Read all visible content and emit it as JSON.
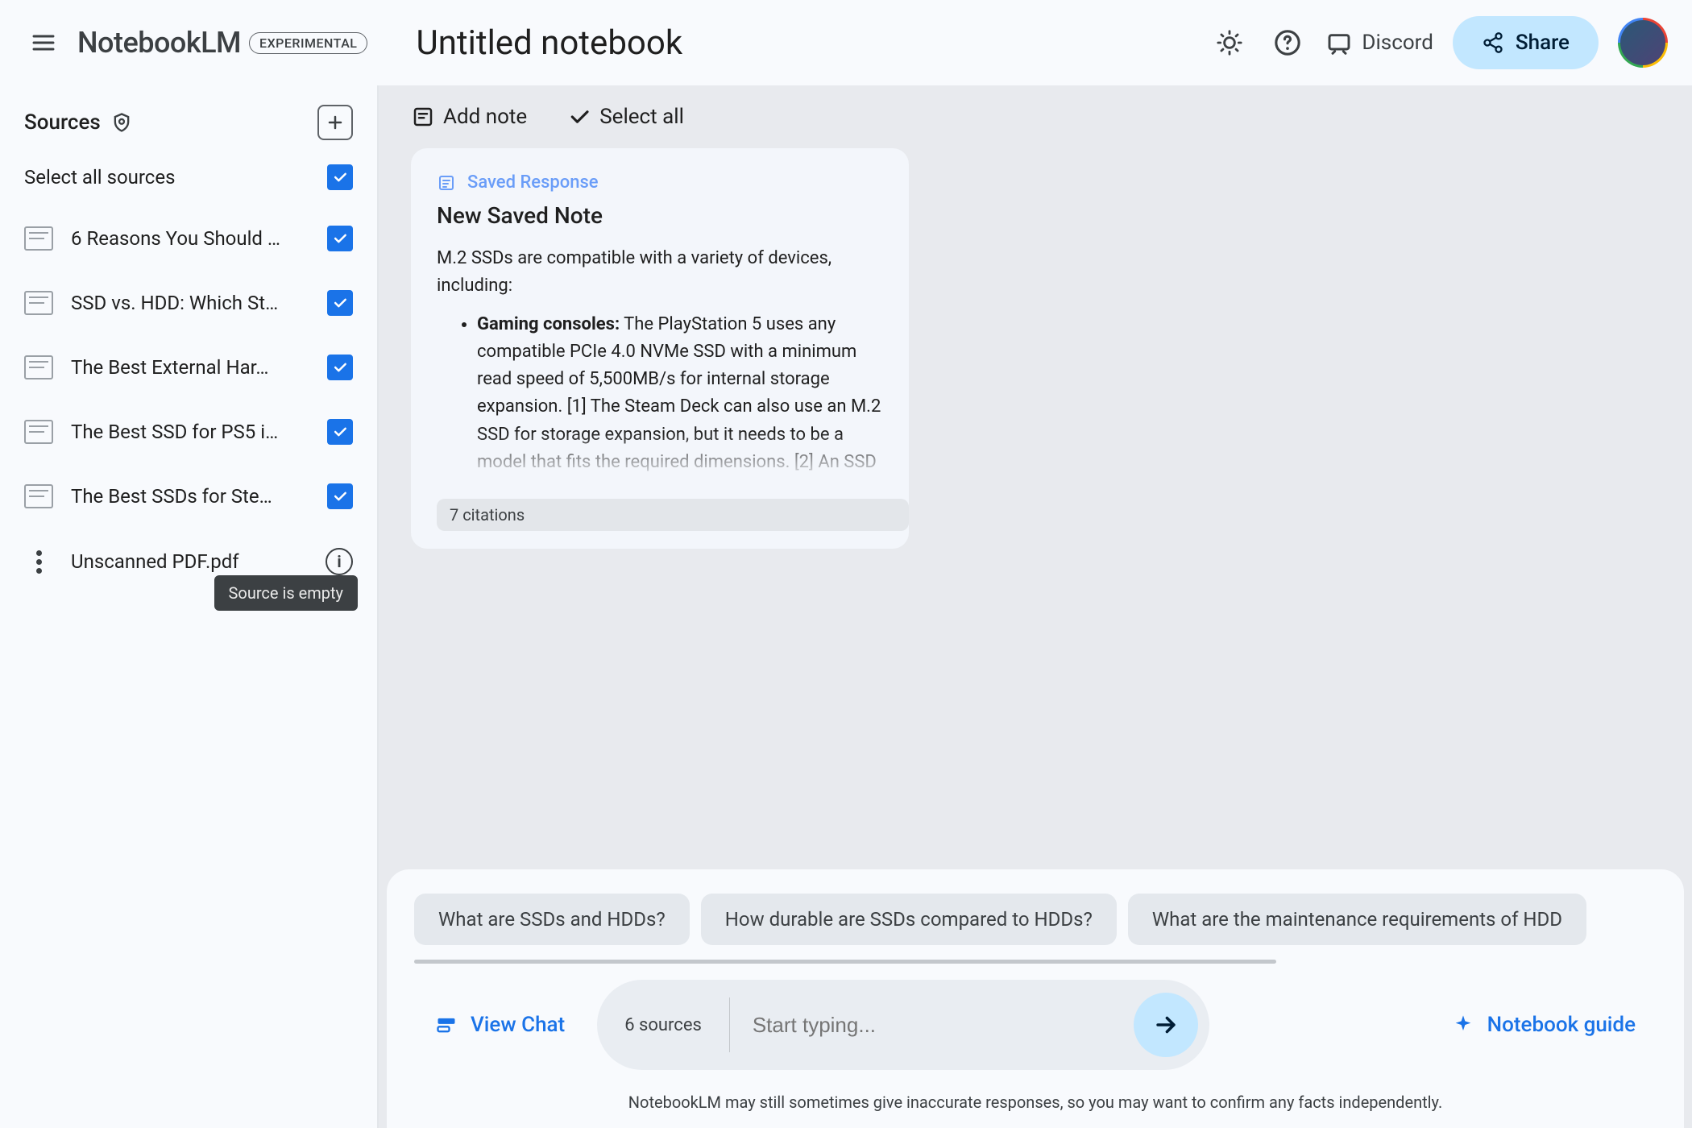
{
  "header": {
    "logo": "NotebookLM",
    "badge": "EXPERIMENTAL",
    "title": "Untitled notebook",
    "discord": "Discord",
    "share": "Share"
  },
  "sidebar": {
    "title": "Sources",
    "select_all": "Select all sources",
    "items": [
      {
        "label": "6 Reasons You Should …"
      },
      {
        "label": "SSD vs. HDD: Which St…"
      },
      {
        "label": "The Best External Har…"
      },
      {
        "label": "The Best SSD for PS5 i…"
      },
      {
        "label": "The Best SSDs for Ste…"
      }
    ],
    "empty_item": "Unscanned PDF.pdf",
    "tooltip": "Source is empty"
  },
  "toolbar": {
    "add_note": "Add note",
    "select_all": "Select all"
  },
  "card": {
    "tag": "Saved Response",
    "title": "New Saved Note",
    "intro": "M.2 SSDs are compatible with a variety of de­vices, including:",
    "bullet_strong": "Gaming consoles:",
    "bullet_text": " The PlayStation 5 uses any compatible PCIe 4.0 NVMe SSD with a minimum read speed of 5,500MB/s for in­ternal storage expansion. [1] The Steam Deck can also use an M.2 SSD for storage expansion, but it needs to be a model that fits the required dimensions. [2] An SSD",
    "citations": "7 citations"
  },
  "chips": [
    "What are SSDs and HDDs?",
    "How durable are SSDs compared to HDDs?",
    "What are the maintenance requirements of HDD"
  ],
  "input": {
    "view_chat": "View Chat",
    "source_count": "6 sources",
    "placeholder": "Start typing...",
    "guide": "Notebook guide"
  },
  "disclaimer": "NotebookLM may still sometimes give inaccurate responses, so you may want to confirm any facts independently."
}
